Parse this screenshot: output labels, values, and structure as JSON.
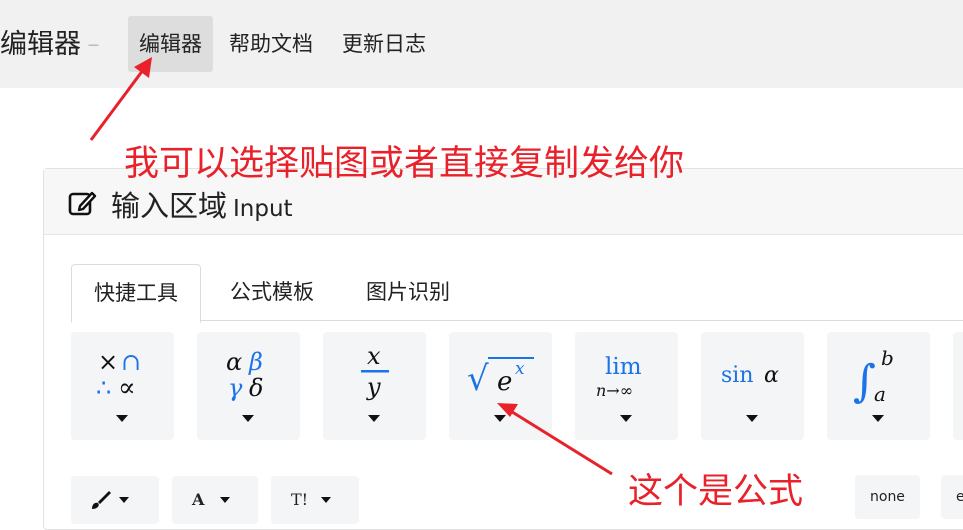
{
  "header": {
    "brand": "编辑器",
    "brand_sub": "—",
    "nav": [
      "编辑器",
      "帮助文档",
      "更新日志"
    ]
  },
  "card": {
    "title": "输入区域",
    "title_sub": "Input",
    "tabs": [
      "快捷工具",
      "公式模板",
      "图片识别"
    ]
  },
  "tools": [
    {
      "icon": "operators-icon",
      "glyphs": [
        "×",
        "∩",
        "∴",
        "∝"
      ]
    },
    {
      "icon": "greek-letters-icon",
      "glyphs": [
        "α",
        "β",
        "γ",
        "δ"
      ]
    },
    {
      "icon": "fraction-icon",
      "glyphs": [
        "x",
        "y"
      ]
    },
    {
      "icon": "radical-exponent-icon",
      "glyphs": [
        "√",
        "e",
        "x"
      ]
    },
    {
      "icon": "limit-icon",
      "glyphs": [
        "lim",
        "n→∞"
      ]
    },
    {
      "icon": "trig-icon",
      "glyphs": [
        "sin",
        "α"
      ]
    },
    {
      "icon": "integral-icon",
      "glyphs": [
        "∫",
        "b",
        "a"
      ]
    }
  ],
  "format_buttons": [
    "",
    "A",
    "T!"
  ],
  "style_pills": [
    "none",
    "e"
  ],
  "annotations": {
    "top": "我可以选择贴图或者直接复制发给你",
    "bottom": "这个是公式"
  },
  "colors": {
    "accent": "#1a73e8",
    "annotation": "#e8212a"
  }
}
